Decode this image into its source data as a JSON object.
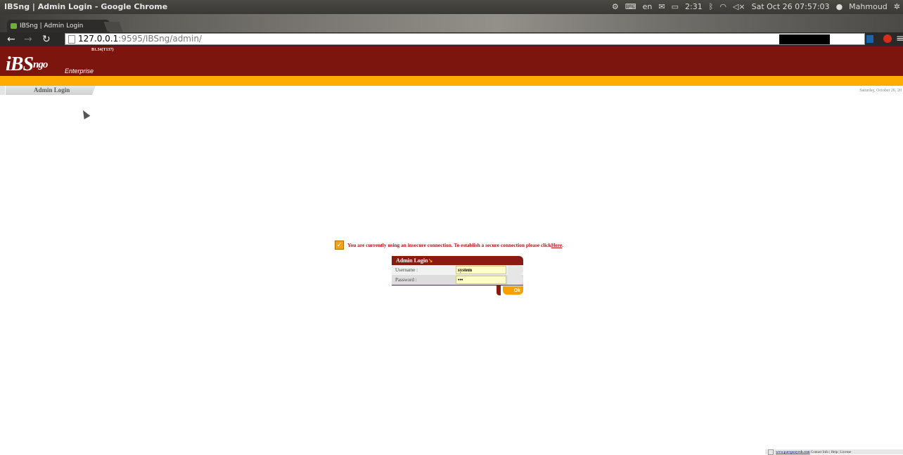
{
  "system_panel": {
    "window_title": "IBSng | Admin Login - Google Chrome",
    "keyboard_layout": "en",
    "battery_time": "2:31",
    "datetime": "Sat Oct 26 07:57:03",
    "user": "Mahmoud"
  },
  "browser": {
    "tab_title": "IBSng | Admin Login",
    "url_host": "127.0.0.1",
    "url_rest": ":9595/IBSng/admin/"
  },
  "header": {
    "logo_main": "iBS",
    "logo_ngo": "ngo",
    "logo_sub": "Enterprise",
    "version": "B1.34(T137)"
  },
  "breadcrumb": {
    "label": "Admin Login",
    "date": "Saturday, October 26, 20"
  },
  "warning": {
    "text": "You are currently using an insecure connection. To establish a secure connection please click",
    "link": "Here",
    "period": "."
  },
  "login": {
    "title": "Admin Login",
    "username_label": "Username :",
    "username_value": "system",
    "password_label": "Password :",
    "password_value": "•••",
    "ok_label": "Ok"
  },
  "footer": {
    "site": "www.parspooyesh.com",
    "links": "Contact Info | Help | License"
  }
}
